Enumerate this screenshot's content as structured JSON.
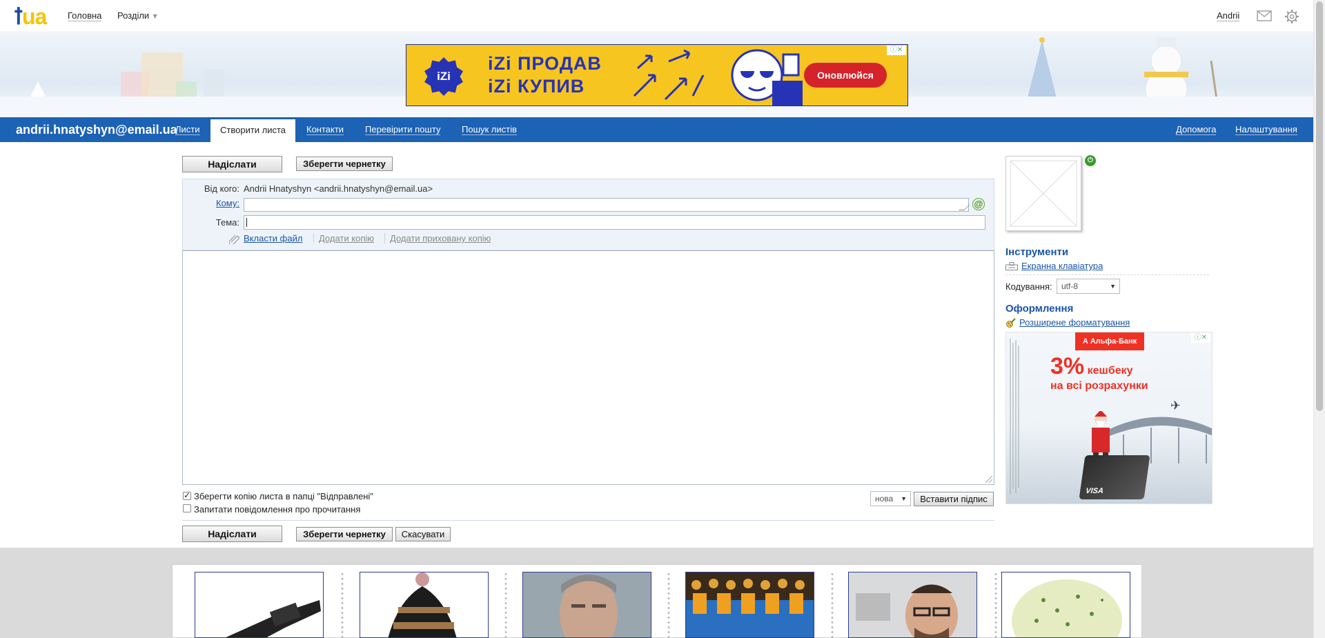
{
  "topbar": {
    "logo_text": "ua",
    "nav_home": "Головна",
    "nav_sections": "Розділи",
    "user": "Andrii"
  },
  "banner_ad": {
    "badge": "iZi",
    "line1": "iZi ПРОДАВ",
    "line2": "iZi КУПИВ",
    "cta": "Оновлюйся",
    "ad_marker": "ⓘ✕"
  },
  "mainnav": {
    "account": "andrii.hnatyshyn@email.ua",
    "tabs": [
      "Листи",
      "Створити листа",
      "Контакти",
      "Перевірити пошту",
      "Пошук листів"
    ],
    "right": [
      "Допомога",
      "Налаштування"
    ]
  },
  "compose": {
    "send": "Надіслати",
    "save_draft": "Зберегти чернетку",
    "cancel": "Скасувати",
    "from_label": "Від кого:",
    "from_value": "Andrii Hnatyshyn <andrii.hnatyshyn@email.ua>",
    "to_label": "Кому:",
    "subject_label": "Тема:",
    "to_value": "",
    "subject_value": "",
    "attach": "Вкласти файл",
    "add_cc": "Додати копію",
    "add_bcc": "Додати приховану копію",
    "save_copy": "Зберегти копію листа в папці \"Відправлені\"",
    "save_copy_checked": true,
    "read_receipt": "Запитати повідомлення про прочитання",
    "read_receipt_checked": false,
    "signature_select": "нова",
    "insert_signature": "Вставити підпис"
  },
  "sidebar": {
    "tools_title": "Інструменти",
    "keyboard_link": "Екранна клавіатура",
    "encoding_label": "Кодування:",
    "encoding_value": "utf-8",
    "design_title": "Оформлення",
    "formatting_link": "Розширене форматування"
  },
  "side_ad": {
    "brand": "А  Альфа-Банк",
    "headline_num": "3%",
    "headline_word": " кешбеку",
    "sub": "на всі розрахунки",
    "card": "VISA",
    "ad_marker": "ⓘ✕"
  },
  "colors": {
    "nav_blue": "#1c62b5",
    "link_blue": "#1a55a8",
    "ad_yellow": "#f7c520",
    "ad_red": "#ef3124"
  },
  "icons": [
    "logo-icon",
    "mail-icon",
    "gear-icon",
    "at-icon",
    "paperclip-icon",
    "power-icon",
    "keyboard-icon",
    "brush-icon"
  ]
}
